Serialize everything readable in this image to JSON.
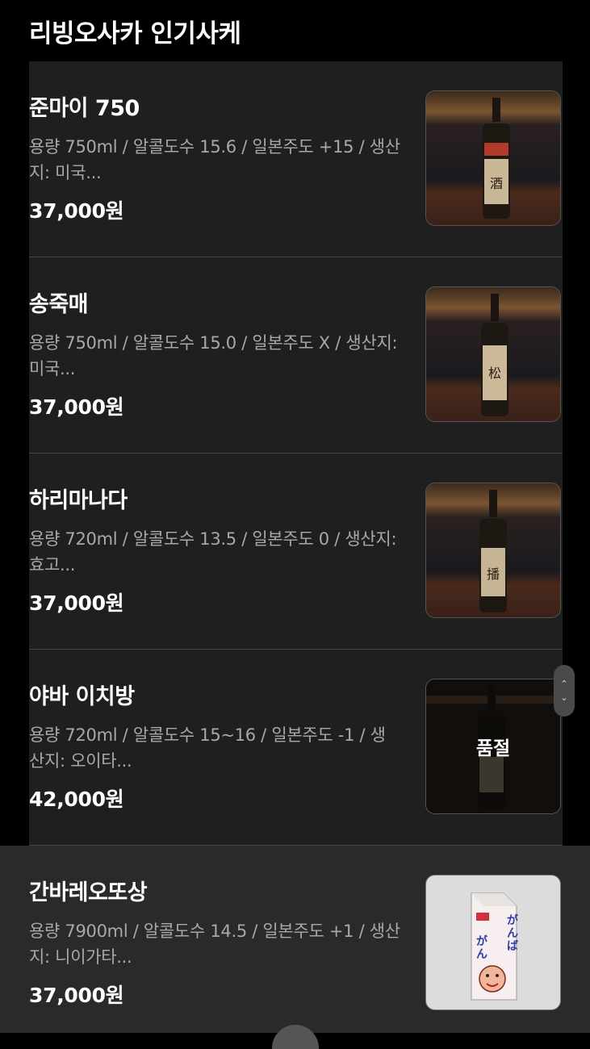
{
  "header": {
    "title": "리빙오사카 인기사케"
  },
  "items": [
    {
      "name": "준마이 750",
      "desc": "용량 750ml / 알콜도수 15.6 / 일본주도 +15 / 생산지: 미국...",
      "price": "37,000원",
      "sold_out": false
    },
    {
      "name": "송죽매",
      "desc": "용량 750ml / 알콜도수 15.0 / 일본주도 X / 생산지: 미국...",
      "price": "37,000원",
      "sold_out": false
    },
    {
      "name": "하리마나다",
      "desc": "용량 720ml / 알콜도수 13.5 / 일본주도 0 / 생산지: 효고...",
      "price": "37,000원",
      "sold_out": false
    },
    {
      "name": "야바 이치방",
      "desc": "용량 720ml / 알콜도수 15~16 / 일본주도 -1 / 생산지: 오이타...",
      "price": "42,000원",
      "sold_out": true,
      "sold_out_label": "품절"
    },
    {
      "name": "간바레오또상",
      "desc": "용량 7900ml / 알콜도수 14.5 / 일본주도 +1 / 생산지: 니이가타...",
      "price": "37,000원",
      "sold_out": false
    }
  ],
  "colors": {
    "background": "#000000",
    "panel": "#1f1f1f",
    "text": "#ffffff",
    "subtext": "#a8a8a8",
    "bottom_area": "#2a2a2a"
  },
  "icons": {
    "scroll_up": "chevron-up-icon",
    "scroll_down": "chevron-down-icon"
  }
}
